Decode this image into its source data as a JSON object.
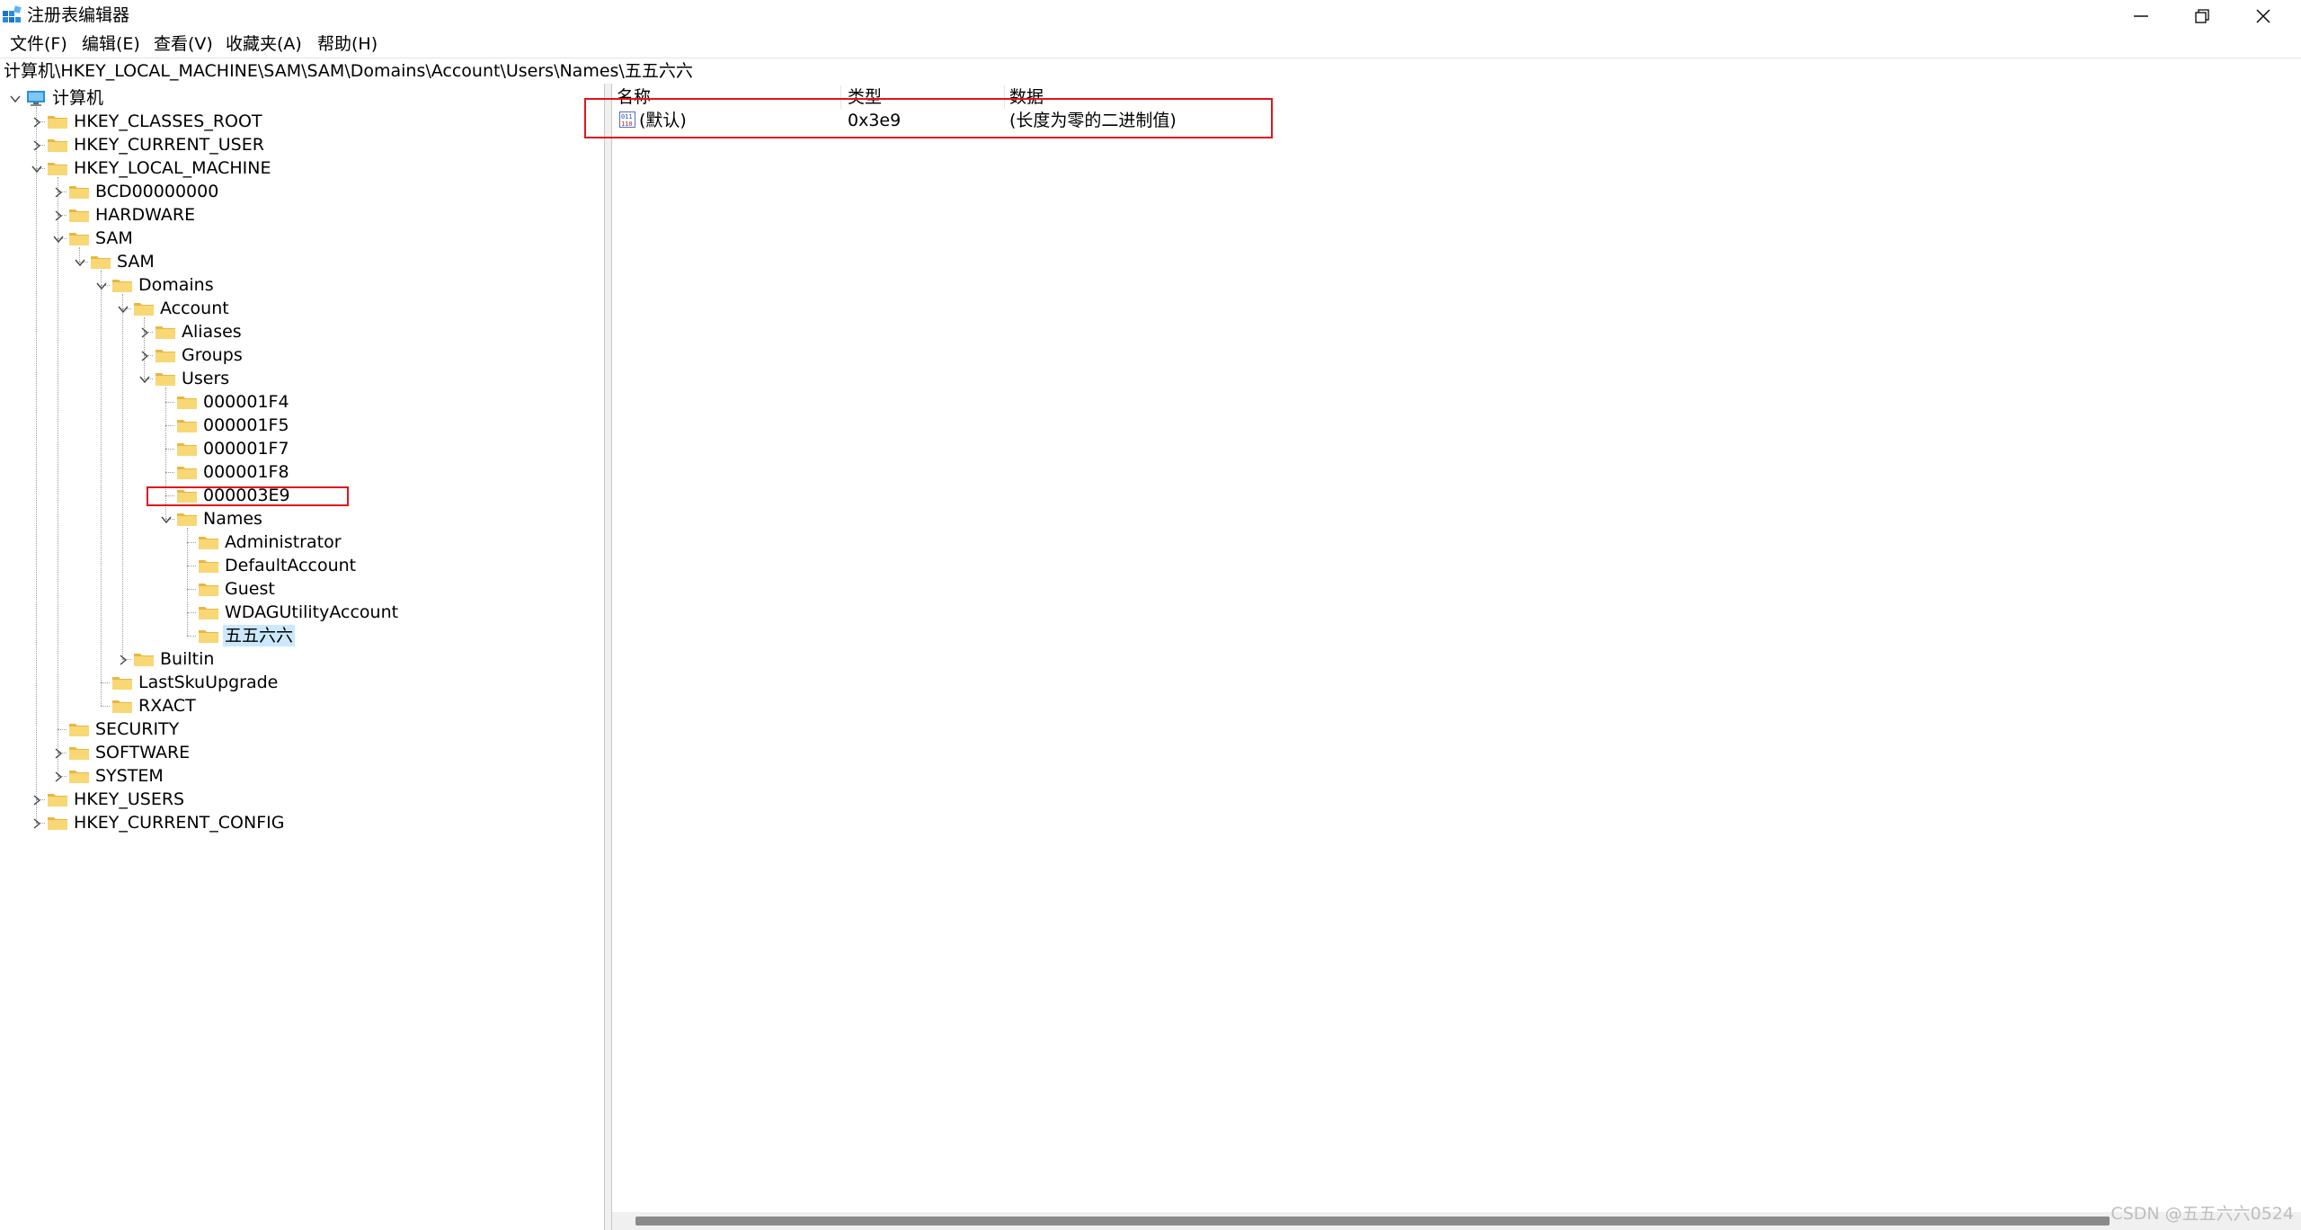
{
  "window": {
    "title": "注册表编辑器",
    "app_icon": "registry-editor-icon",
    "controls": [
      "minimize-icon",
      "maximize-icon",
      "close-icon"
    ]
  },
  "menu": [
    {
      "label": "文件(F)"
    },
    {
      "label": "编辑(E)"
    },
    {
      "label": "查看(V)"
    },
    {
      "label": "收藏夹(A)"
    },
    {
      "label": "帮助(H)"
    }
  ],
  "address": {
    "path": "计算机\\HKEY_LOCAL_MACHINE\\SAM\\SAM\\Domains\\Account\\Users\\Names\\五五六六"
  },
  "tree": {
    "nodes": [
      {
        "label": "计算机",
        "icon": "computer-icon",
        "level": 0,
        "expander": "expanded"
      },
      {
        "label": "HKEY_CLASSES_ROOT",
        "icon": "folder-icon",
        "level": 1,
        "expander": "collapsed"
      },
      {
        "label": "HKEY_CURRENT_USER",
        "icon": "folder-icon",
        "level": 1,
        "expander": "collapsed"
      },
      {
        "label": "HKEY_LOCAL_MACHINE",
        "icon": "folder-icon",
        "level": 1,
        "expander": "expanded"
      },
      {
        "label": "BCD00000000",
        "icon": "folder-icon",
        "level": 2,
        "expander": "collapsed"
      },
      {
        "label": "HARDWARE",
        "icon": "folder-icon",
        "level": 2,
        "expander": "collapsed"
      },
      {
        "label": "SAM",
        "icon": "folder-icon",
        "level": 2,
        "expander": "expanded"
      },
      {
        "label": "SAM",
        "icon": "folder-icon",
        "level": 3,
        "expander": "expanded"
      },
      {
        "label": "Domains",
        "icon": "folder-icon",
        "level": 4,
        "expander": "expanded"
      },
      {
        "label": "Account",
        "icon": "folder-icon",
        "level": 5,
        "expander": "expanded"
      },
      {
        "label": "Aliases",
        "icon": "folder-icon",
        "level": 6,
        "expander": "collapsed"
      },
      {
        "label": "Groups",
        "icon": "folder-icon",
        "level": 6,
        "expander": "collapsed"
      },
      {
        "label": "Users",
        "icon": "folder-icon",
        "level": 6,
        "expander": "expanded"
      },
      {
        "label": "000001F4",
        "icon": "folder-icon",
        "level": 7,
        "expander": "none"
      },
      {
        "label": "000001F5",
        "icon": "folder-icon",
        "level": 7,
        "expander": "none"
      },
      {
        "label": "000001F7",
        "icon": "folder-icon",
        "level": 7,
        "expander": "none"
      },
      {
        "label": "000001F8",
        "icon": "folder-icon",
        "level": 7,
        "expander": "none"
      },
      {
        "label": "000003E9",
        "icon": "folder-icon",
        "level": 7,
        "expander": "none"
      },
      {
        "label": "Names",
        "icon": "folder-icon",
        "level": 7,
        "expander": "expanded"
      },
      {
        "label": "Administrator",
        "icon": "folder-icon",
        "level": 8,
        "expander": "none"
      },
      {
        "label": "DefaultAccount",
        "icon": "folder-icon",
        "level": 8,
        "expander": "none"
      },
      {
        "label": "Guest",
        "icon": "folder-icon",
        "level": 8,
        "expander": "none"
      },
      {
        "label": "WDAGUtilityAccount",
        "icon": "folder-icon",
        "level": 8,
        "expander": "none"
      },
      {
        "label": "五五六六",
        "icon": "folder-icon",
        "level": 8,
        "expander": "none",
        "selected": true
      },
      {
        "label": "Builtin",
        "icon": "folder-icon",
        "level": 5,
        "expander": "collapsed"
      },
      {
        "label": "LastSkuUpgrade",
        "icon": "folder-icon",
        "level": 4,
        "expander": "none"
      },
      {
        "label": "RXACT",
        "icon": "folder-icon",
        "level": 4,
        "expander": "none"
      },
      {
        "label": "SECURITY",
        "icon": "folder-icon",
        "level": 2,
        "expander": "none"
      },
      {
        "label": "SOFTWARE",
        "icon": "folder-icon",
        "level": 2,
        "expander": "collapsed"
      },
      {
        "label": "SYSTEM",
        "icon": "folder-icon",
        "level": 2,
        "expander": "collapsed"
      },
      {
        "label": "HKEY_USERS",
        "icon": "folder-icon",
        "level": 1,
        "expander": "collapsed"
      },
      {
        "label": "HKEY_CURRENT_CONFIG",
        "icon": "folder-icon",
        "level": 1,
        "expander": "collapsed"
      }
    ]
  },
  "values_list": {
    "columns": {
      "name": "名称",
      "type": "类型",
      "data": "数据"
    },
    "rows": [
      {
        "name": "(默认)",
        "type": "0x3e9",
        "data": "(长度为零的二进制值)",
        "icon": "binary-value-icon"
      }
    ]
  },
  "colors": {
    "annotation": "#e2141b",
    "selection": "#cce8ff",
    "folder": "#f8d775"
  },
  "watermark": "CSDN @五五六六0524"
}
